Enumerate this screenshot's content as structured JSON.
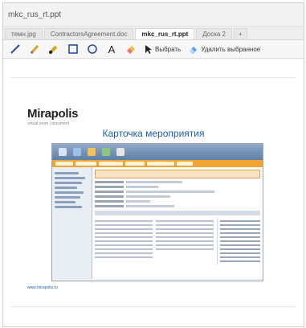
{
  "window": {
    "title": "mkc_rus_rt.ppt"
  },
  "tabs": [
    {
      "label": "темн.jpg"
    },
    {
      "label": "ContractorsAgreement.doc"
    },
    {
      "label": "mkc_rus_rt.ppt"
    },
    {
      "label": "Доска 2"
    },
    {
      "label": "+"
    }
  ],
  "toolbar": {
    "tools": [
      "pen-icon",
      "pencil-icon",
      "marker-icon",
      "rectangle-icon",
      "circle-icon",
      "text-icon",
      "eraser-icon"
    ],
    "text_tool_glyph": "A",
    "select_label": "Выбрать",
    "delete_selected_label": "Удалить выбранное"
  },
  "slide": {
    "brand": "Mirapolis",
    "brand_sub": "virtual room  |  document",
    "title": "Карточка мероприятия",
    "footer_link": "www.mirapolis.ru"
  },
  "colors": {
    "title_blue": "#1e5da8",
    "accent_orange": "#f0a533"
  }
}
